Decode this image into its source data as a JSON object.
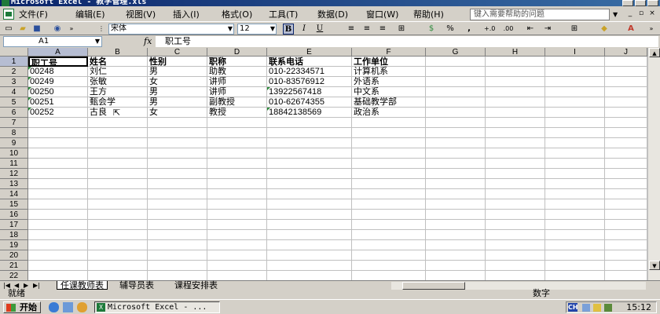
{
  "window": {
    "title": "Microsoft Excel - 教学管理.xls"
  },
  "menu": [
    {
      "id": "file",
      "label": "文件(F)"
    },
    {
      "id": "edit",
      "label": "编辑(E)"
    },
    {
      "id": "view",
      "label": "视图(V)"
    },
    {
      "id": "insert",
      "label": "插入(I)"
    },
    {
      "id": "format",
      "label": "格式(O)"
    },
    {
      "id": "tools",
      "label": "工具(T)"
    },
    {
      "id": "data",
      "label": "数据(D)"
    },
    {
      "id": "window",
      "label": "窗口(W)"
    },
    {
      "id": "help",
      "label": "帮助(H)"
    }
  ],
  "help_search": {
    "placeholder": "键入需要帮助的问题"
  },
  "toolbar": {
    "font_name": "宋体",
    "font_size": "12",
    "bold_label": "B",
    "italic_label": "I",
    "underline_label": "U",
    "percent_label": "%",
    "comma_label": ",",
    "accent_color": "#0a246a"
  },
  "formula_bar": {
    "name_box": "A1",
    "fx_label": "fx",
    "content": "职工号"
  },
  "columns": [
    "A",
    "B",
    "C",
    "D",
    "E",
    "F",
    "G",
    "H",
    "I",
    "J"
  ],
  "rows": [
    "1",
    "2",
    "3",
    "4",
    "5",
    "6",
    "7",
    "8",
    "9",
    "10",
    "11",
    "12",
    "13",
    "14",
    "15",
    "16",
    "17",
    "18",
    "19",
    "20",
    "21",
    "22"
  ],
  "table": {
    "headers": [
      "职工号",
      "姓名",
      "性别",
      "职称",
      "联系电话",
      "工作单位"
    ],
    "rows": [
      [
        "00248",
        "刘仁",
        "男",
        "助教",
        "010-22334571",
        "计算机系"
      ],
      [
        "00249",
        "张敏",
        "女",
        "讲师",
        "010-83576912",
        "外语系"
      ],
      [
        "00250",
        "王方",
        "男",
        "讲师",
        "13922567418",
        "中文系"
      ],
      [
        "00251",
        "甄会学",
        "男",
        "副教授",
        "010-62674355",
        "基础教学部"
      ],
      [
        "00252",
        "古良",
        "女",
        "教授",
        "18842138569",
        "政治系"
      ]
    ]
  },
  "sheet_tabs": [
    {
      "label": "任课教师表",
      "active": true
    },
    {
      "label": "辅导员表",
      "active": false
    },
    {
      "label": "课程安排表",
      "active": false
    }
  ],
  "status": {
    "ready": "就绪",
    "num": "数字"
  },
  "taskbar": {
    "start": "开始",
    "app": "Microsoft Excel - ...",
    "clock": "15:12",
    "ime": "CH"
  }
}
